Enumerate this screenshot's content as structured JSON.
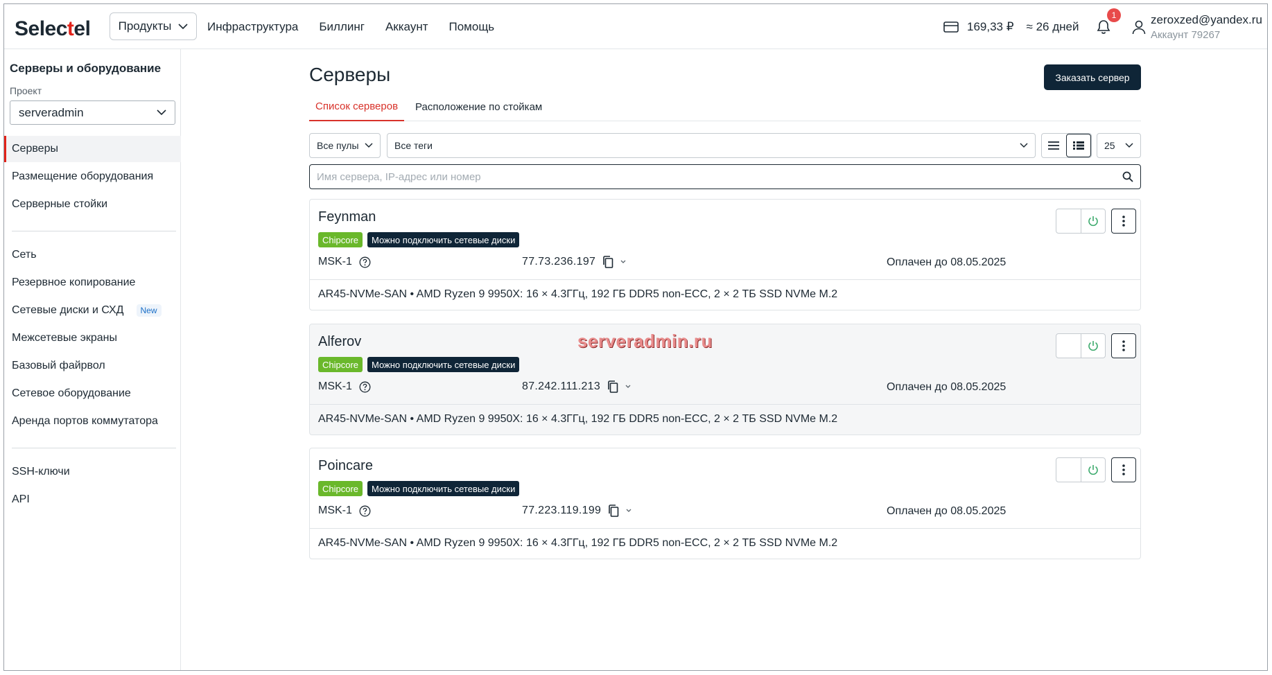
{
  "header": {
    "logo_prefix": "S",
    "logo_mid": "elec",
    "logo_red": "t",
    "logo_suffix": "el",
    "products_label": "Продукты",
    "nav": [
      "Инфраструктура",
      "Биллинг",
      "Аккаунт",
      "Помощь"
    ],
    "balance": "169,33 ₽",
    "days": "≈ 26 дней",
    "notifications_count": "1",
    "user_email": "zeroxzed@yandex.ru",
    "user_account": "Аккаунт 79267"
  },
  "sidebar": {
    "title": "Серверы и оборудование",
    "project_label": "Проект",
    "project_value": "serveradmin",
    "group1": [
      "Серверы",
      "Размещение оборудования",
      "Серверные стойки"
    ],
    "group2": [
      "Сеть",
      "Резервное копирование",
      "Сетевые диски и СХД",
      "Межсетевые экраны",
      "Базовый файрвол",
      "Сетевое оборудование",
      "Аренда портов коммутатора"
    ],
    "new_badge": "New",
    "group3": [
      "SSH-ключи",
      "API"
    ]
  },
  "main": {
    "title": "Серверы",
    "order_button": "Заказать сервер",
    "tabs": [
      "Список серверов",
      "Расположение по стойкам"
    ],
    "pool_filter": "Все пулы",
    "tags_filter": "Все теги",
    "page_size": "25",
    "search_placeholder": "Имя сервера, IP-адрес или номер"
  },
  "servers": [
    {
      "name": "Feynman",
      "tag1": "Chipcore",
      "tag2": "Можно подключить сетевые диски",
      "location": "MSK-1",
      "ip": "77.73.236.197",
      "paid": "Оплачен до 08.05.2025",
      "config": "AR45-NVMe-SAN •  AMD Ryzen 9 9950X: 16 × 4.3ГГц, 192 ГБ DDR5 non-ECC, 2 × 2 ТБ SSD NVMe M.2"
    },
    {
      "name": "Alferov",
      "tag1": "Chipcore",
      "tag2": "Можно подключить сетевые диски",
      "location": "MSK-1",
      "ip": "87.242.111.213",
      "paid": "Оплачен до 08.05.2025",
      "config": "AR45-NVMe-SAN •  AMD Ryzen 9 9950X: 16 × 4.3ГГц, 192 ГБ DDR5 non-ECC, 2 × 2 ТБ SSD NVMe M.2"
    },
    {
      "name": "Poincare",
      "tag1": "Chipcore",
      "tag2": "Можно подключить сетевые диски",
      "location": "MSK-1",
      "ip": "77.223.119.199",
      "paid": "Оплачен до 08.05.2025",
      "config": "AR45-NVMe-SAN •  AMD Ryzen 9 9950X: 16 × 4.3ГГц, 192 ГБ DDR5 non-ECC, 2 × 2 ТБ SSD NVMe M.2"
    }
  ],
  "watermark": "serveradmin.ru",
  "colors": {
    "brand_red": "#e2231a",
    "dark": "#0f2537",
    "chip_green": "#6ab82b",
    "power_green": "#3aa96b"
  },
  "icons": {
    "products": "chevron-down-icon",
    "wallet": "card-icon",
    "bell": "bell-icon",
    "user": "user-icon",
    "search": "search-icon",
    "copy": "copy-icon",
    "help": "question-circle-icon",
    "power": "power-icon",
    "more": "kebab-icon"
  }
}
